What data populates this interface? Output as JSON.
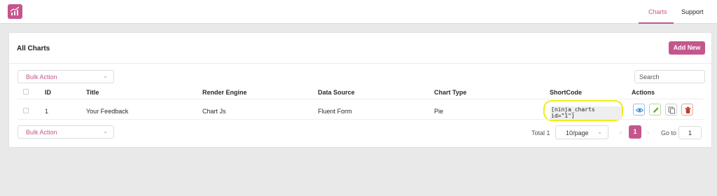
{
  "nav": {
    "charts_label": "Charts",
    "support_label": "Support"
  },
  "header": {
    "title": "All Charts",
    "add_new_label": "Add New"
  },
  "bulk_action": {
    "top_placeholder": "Bulk Action",
    "bottom_placeholder": "Bulk Action"
  },
  "search": {
    "placeholder": "Search"
  },
  "table": {
    "columns": [
      "ID",
      "Title",
      "Render Engine",
      "Data Source",
      "Chart Type",
      "ShortCode",
      "Actions"
    ],
    "rows": [
      {
        "id": "1",
        "title": "Your Feedback",
        "render_engine": "Chart Js",
        "data_source": "Fluent Form",
        "chart_type": "Pie",
        "shortcode": "[ninja_charts id=\"1\"]"
      }
    ]
  },
  "pagination": {
    "total": "Total 1",
    "page_size": "10/page",
    "current_page": "1",
    "goto_label": "Go to",
    "goto_value": "1"
  },
  "icons": {
    "logo": "bar-chart-trend-icon",
    "view": "eye-icon",
    "edit": "pencil-icon",
    "copy": "copy-icon",
    "delete": "trash-icon"
  },
  "colors": {
    "accent": "#c5568c",
    "highlight": "#f0ec1c",
    "view": "#3b82c4",
    "edit": "#5aa02c",
    "delete": "#c0392b"
  }
}
